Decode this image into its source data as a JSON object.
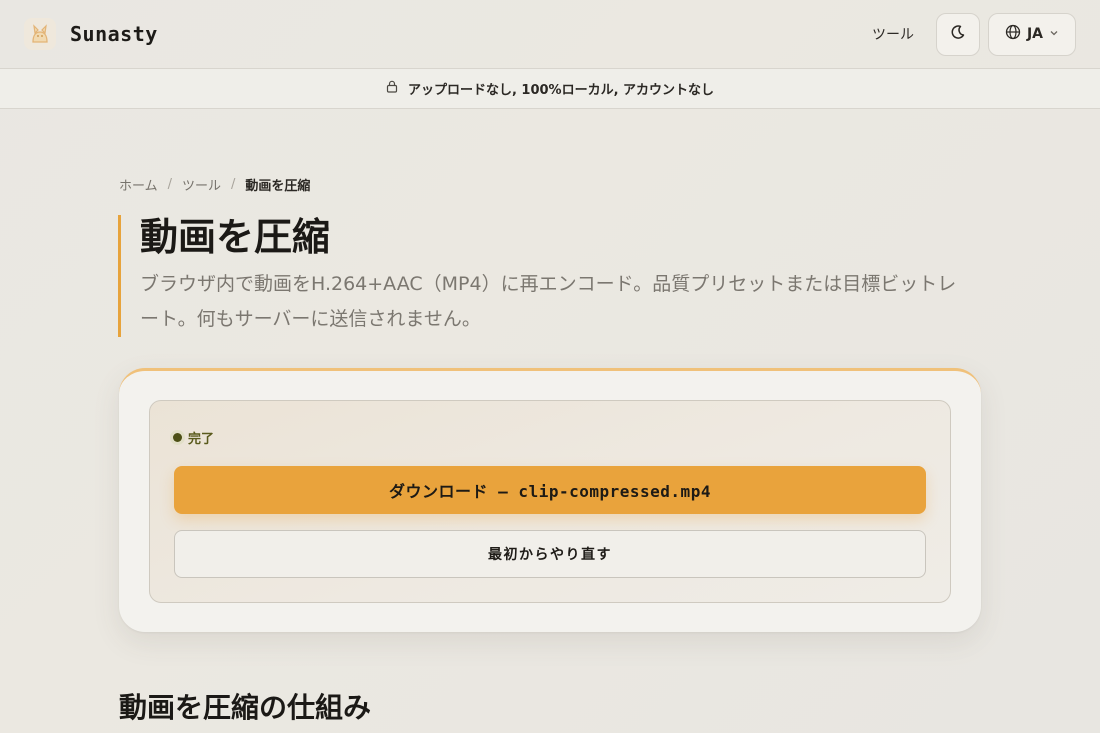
{
  "header": {
    "brand": "Sunasty",
    "logo_icon": "cat-logo-icon",
    "nav_tools": "ツール",
    "theme_icon": "moon-icon",
    "lang_icon": "globe-icon",
    "lang_label": "JA",
    "lang_chevron_icon": "chevron-down-icon"
  },
  "banner": {
    "icon": "lock-icon",
    "text": "アップロードなし, 100%ローカル, アカウントなし"
  },
  "breadcrumb": {
    "items": [
      "ホーム",
      "ツール",
      "動画を圧縮"
    ],
    "separator": "/"
  },
  "page": {
    "title": "動画を圧縮",
    "description": "ブラウザ内で動画をH.264+AAC（MP4）に再エンコード。品質プリセットまたは目標ビットレート。何もサーバーに送信されません。"
  },
  "result": {
    "status": "完了",
    "status_color": "#4d4f15",
    "download_label": "ダウンロード — clip-compressed.mp4",
    "restart_label": "最初からやり直す",
    "accent_color": "#e9a33c"
  },
  "section": {
    "title": "動画を圧縮の仕組み"
  }
}
